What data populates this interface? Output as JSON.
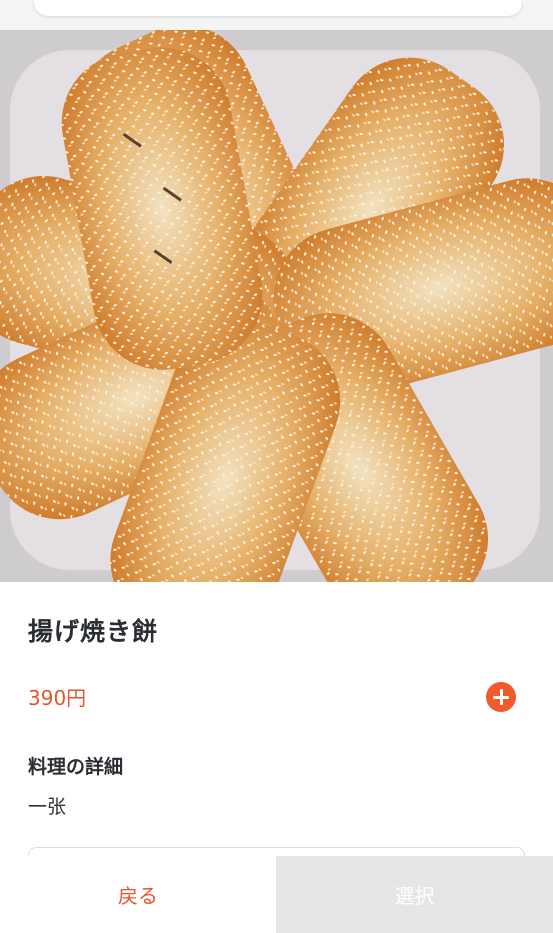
{
  "item": {
    "name": "揚げ焼き餅",
    "price": "390円",
    "details_heading": "料理の詳細",
    "details_value": "一张"
  },
  "actions": {
    "add_icon": "plus-circle-icon",
    "back_label": "戻る",
    "select_label": "選択",
    "select_enabled": false
  },
  "colors": {
    "accent": "#f15a2b",
    "price_text": "#e5552d",
    "title_text": "#2a2d34",
    "disabled_button_bg": "#e6e6e6"
  }
}
